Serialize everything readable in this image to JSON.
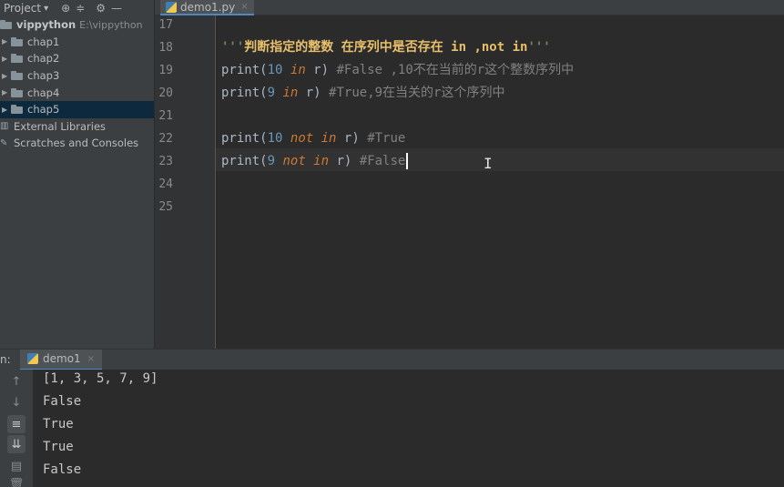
{
  "project_panel": {
    "title": "Project",
    "title_arrow": "▾",
    "header_icons": [
      "target-icon",
      "collapse-icon",
      "gear-icon",
      "minimize-icon"
    ],
    "root": {
      "name": "vippython",
      "path": "E:\\vippython"
    },
    "items": [
      {
        "label": "chap1"
      },
      {
        "label": "chap2"
      },
      {
        "label": "chap3"
      },
      {
        "label": "chap4"
      },
      {
        "label": "chap5"
      }
    ],
    "external_libraries": "External Libraries",
    "scratches": "Scratches and Consoles"
  },
  "editor": {
    "tab": {
      "label": "demo1.py",
      "close": "×"
    },
    "line_numbers": [
      "17",
      "18",
      "19",
      "20",
      "21",
      "22",
      "23",
      "24",
      "25"
    ],
    "lines": {
      "l18": {
        "q1": "'''",
        "text": "判断指定的整数 在序列中是否存在 in ,not in",
        "q2": "'''"
      },
      "l19": {
        "fn": "print",
        "p1": "(",
        "n": "10",
        "sp1": " ",
        "kw": "in",
        "rest": " r) ",
        "cm": "#False ,10不在当前的r这个整数序列中"
      },
      "l20": {
        "fn": "print",
        "p1": "(",
        "n": "9",
        "sp1": " ",
        "kw": "in",
        "rest": " r) ",
        "cm": "#True,9在当关的r这个序列中"
      },
      "l22": {
        "fn": "print",
        "p1": "(",
        "n": "10",
        "sp1": " ",
        "kw": "not in",
        "rest": " r) ",
        "cm": "#True"
      },
      "l23": {
        "fn": "print",
        "p1": "(",
        "n": "9",
        "sp1": " ",
        "kw": "not in",
        "rest": " r) ",
        "cm": "#False"
      }
    },
    "cursor_glyph": "I"
  },
  "run_panel": {
    "label": "n:",
    "tab_label": "demo1",
    "tab_close": "×",
    "toolbar": [
      "up-arrow-icon",
      "down-arrow-icon",
      "soft-wrap-icon",
      "scroll-to-end-icon",
      "print-icon",
      "trash-icon"
    ],
    "output": [
      "[1, 3, 5, 7, 9]",
      "False",
      "True",
      "True",
      "False"
    ]
  },
  "colors": {
    "background": "#2b2b2b",
    "panel": "#3c3f41",
    "keyword": "#cc7832",
    "number": "#6897bb",
    "comment": "#808080",
    "string": "#6a8759",
    "selection": "#0d293e"
  }
}
